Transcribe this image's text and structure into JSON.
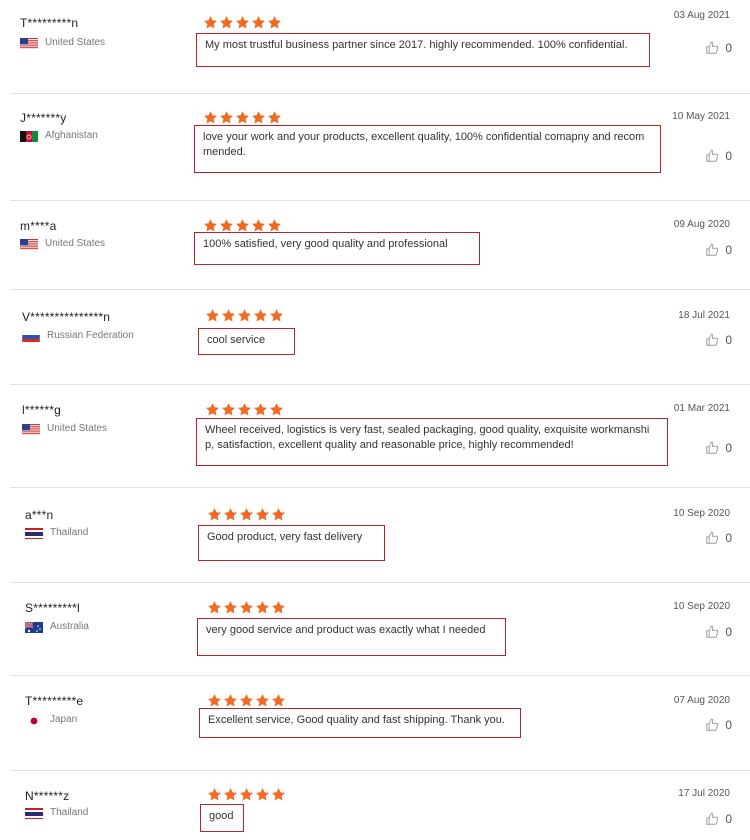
{
  "colors": {
    "star": "#f26a21",
    "comment_border": "#b5262c",
    "divider": "#e2e2e2"
  },
  "icons": {
    "star": "star-icon",
    "like": "thumbs-up-icon"
  },
  "reviews": [
    {
      "name": "T*********n",
      "country": "United States",
      "flag": "us",
      "rating": 5,
      "date": "03 Aug 2021",
      "comment": "My most trustful business partner since 2017. highly recommended. 100% confidential.",
      "likes": "0"
    },
    {
      "name": "J*******y",
      "country": "Afghanistan",
      "flag": "af",
      "rating": 5,
      "date": "10 May 2021",
      "comment": "love your work and your products, excellent quality, 100% confidential comapny and recom mended.",
      "likes": "0"
    },
    {
      "name": "m****a",
      "country": "United States",
      "flag": "us",
      "rating": 5,
      "date": "09 Aug 2020",
      "comment": "100% satisfied, very good quality and professional",
      "likes": "0"
    },
    {
      "name": "V***************n",
      "country": "Russian Federation",
      "flag": "ru",
      "rating": 5,
      "date": "18 Jul 2021",
      "comment": "cool service",
      "likes": "0"
    },
    {
      "name": "l******g",
      "country": "United States",
      "flag": "us",
      "rating": 5,
      "date": "01 Mar 2021",
      "comment": "Wheel received, logistics is very fast, sealed packaging, good quality, exquisite workmanshi p, satisfaction, excellent quality and reasonable price, highly recommended!",
      "likes": "0"
    },
    {
      "name": "a***n",
      "country": "Thailand",
      "flag": "th",
      "rating": 5,
      "date": "10 Sep 2020",
      "comment": "Good product, very fast delivery",
      "likes": "0"
    },
    {
      "name": "S*********l",
      "country": "Australia",
      "flag": "au",
      "rating": 5,
      "date": "10 Sep 2020",
      "comment": "very good service and product was exactly what I needed",
      "likes": "0"
    },
    {
      "name": "T*********e",
      "country": "Japan",
      "flag": "jp",
      "rating": 5,
      "date": "07 Aug 2020",
      "comment": "Excellent service, Good quality and fast shipping. Thank you.",
      "likes": "0"
    },
    {
      "name": "N******z",
      "country": "Thailand",
      "flag": "th",
      "rating": 5,
      "date": "17 Jul 2020",
      "comment": "good",
      "likes": "0"
    }
  ]
}
